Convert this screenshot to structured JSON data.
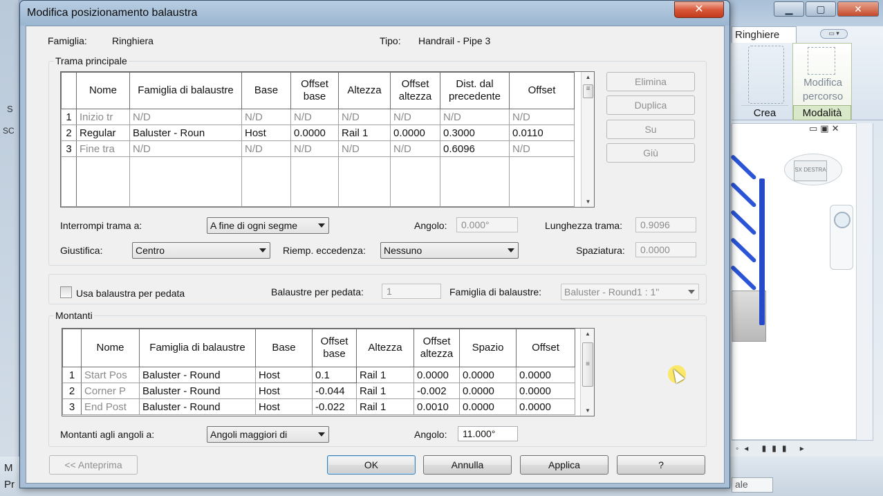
{
  "app": {
    "ribbon_tab": "Ringhiere",
    "ribbon_btn_modifica": "Modifica percorso",
    "ribbon_group_crea": "Crea",
    "ribbon_group_modalita": "Modalità",
    "status_left_1": "M",
    "status_left_2": "Pr",
    "status_combo": "ale",
    "viewcube_label": "SX DESTRA",
    "left_strip_1": "S",
    "left_strip_2": "SC"
  },
  "dialog": {
    "title": "Modifica posizionamento balaustra",
    "close_glyph": "✕",
    "famiglia_label": "Famiglia:",
    "famiglia_value": "Ringhiera",
    "tipo_label": "Tipo:",
    "tipo_value": "Handrail - Pipe 3",
    "main": {
      "group_title": "Trama principale",
      "columns": [
        "Nome",
        "Famiglia di balaustre",
        "Base",
        "Offset base",
        "Altezza",
        "Offset altezza",
        "Dist. dal precedente",
        "Offset"
      ],
      "rows": [
        {
          "n": "1",
          "nome": "Inizio tr",
          "fam": "N/D",
          "base": "N/D",
          "offb": "N/D",
          "alt": "N/D",
          "offa": "N/D",
          "dist": "N/D",
          "off": "N/D"
        },
        {
          "n": "2",
          "nome": "Regular",
          "fam": "Baluster - Roun",
          "base": "Host",
          "offb": "0.0000",
          "alt": "Rail 1",
          "offa": "0.0000",
          "dist": "0.3000",
          "off": "0.0110"
        },
        {
          "n": "3",
          "nome": "Fine tra",
          "fam": "N/D",
          "base": "N/D",
          "offb": "N/D",
          "alt": "N/D",
          "offa": "N/D",
          "dist": "0.6096",
          "off": "N/D"
        }
      ],
      "buttons": [
        "Elimina",
        "Duplica",
        "Su",
        "Giù"
      ],
      "interrompi_label": "Interrompi trama a:",
      "interrompi_value": "A fine di ogni segme",
      "angolo_label": "Angolo:",
      "angolo_value": "0.000°",
      "lunghezza_label": "Lunghezza trama:",
      "lunghezza_value": "0.9096",
      "giustifica_label": "Giustifica:",
      "giustifica_value": "Centro",
      "riemp_label": "Riemp. eccedenza:",
      "riemp_value": "Nessuno",
      "spaziatura_label": "Spaziatura:",
      "spaziatura_value": "0.0000"
    },
    "pedata": {
      "usa_label": "Usa balaustra per pedata",
      "per_pedata_label": "Balaustre per pedata:",
      "per_pedata_value": "1",
      "famiglia_label": "Famiglia di balaustre:",
      "famiglia_value": "Baluster - Round1 : 1\""
    },
    "montanti": {
      "group_title": "Montanti",
      "columns": [
        "Nome",
        "Famiglia di balaustre",
        "Base",
        "Offset base",
        "Altezza",
        "Offset altezza",
        "Spazio",
        "Offset"
      ],
      "rows": [
        {
          "n": "1",
          "nome": "Start Pos",
          "fam": "Baluster - Round",
          "base": "Host",
          "offb": "0.1",
          "alt": "Rail 1",
          "offa": "0.0000",
          "spazio": "0.0000",
          "off": "0.0000"
        },
        {
          "n": "2",
          "nome": "Corner P",
          "fam": "Baluster - Round",
          "base": "Host",
          "offb": "-0.044",
          "alt": "Rail 1",
          "offa": "-0.002",
          "spazio": "0.0000",
          "off": "0.0000"
        },
        {
          "n": "3",
          "nome": "End Post",
          "fam": "Baluster - Round",
          "base": "Host",
          "offb": "-0.022",
          "alt": "Rail 1",
          "offa": "0.0010",
          "spazio": "0.0000",
          "off": "0.0000"
        }
      ],
      "angoli_label": "Montanti agli angoli a:",
      "angoli_value": "Angoli maggiori di",
      "angolo_label": "Angolo:",
      "angolo_value": "11.000°"
    },
    "footer": {
      "anteprima": "<< Anteprima",
      "ok": "OK",
      "annulla": "Annulla",
      "applica": "Applica",
      "help": "?"
    }
  }
}
